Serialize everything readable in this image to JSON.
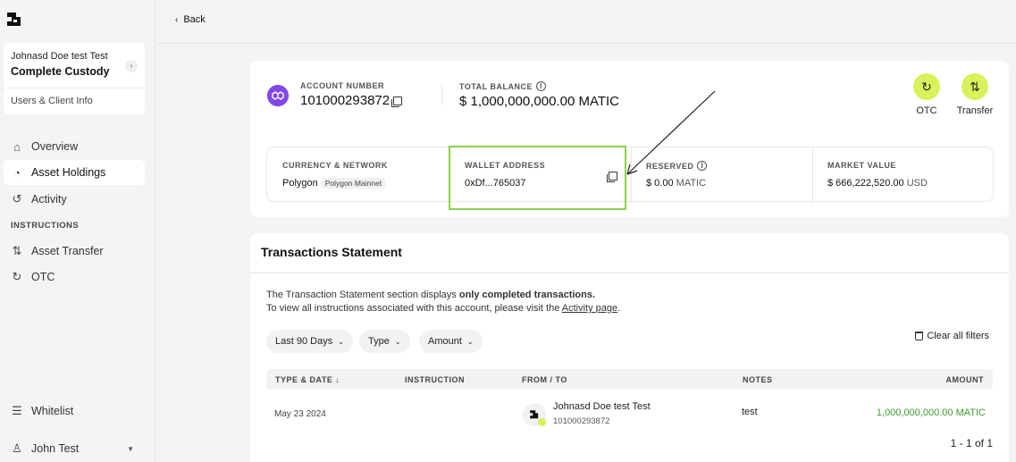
{
  "sidebar": {
    "client": {
      "name": "Johnasd Doe test Test",
      "type": "Complete Custody",
      "users_link": "Users & Client Info"
    },
    "nav": [
      {
        "label": "Overview",
        "icon": "home-icon"
      },
      {
        "label": "Asset Holdings",
        "icon": "pie-chart-icon",
        "active": true
      },
      {
        "label": "Activity",
        "icon": "history-icon"
      }
    ],
    "instructions_heading": "INSTRUCTIONS",
    "instructions": [
      {
        "label": "Asset Transfer",
        "icon": "transfer-arrows-icon"
      },
      {
        "label": "OTC",
        "icon": "refresh-icon"
      }
    ],
    "whitelist": "Whitelist",
    "user": "John Test"
  },
  "header": {
    "back": "Back"
  },
  "account": {
    "number_label": "ACCOUNT NUMBER",
    "number": "101000293872",
    "balance_label": "TOTAL BALANCE",
    "balance": "$ 1,000,000,000.00 MATIC",
    "otc_label": "OTC",
    "transfer_label": "Transfer",
    "currency_label": "CURRENCY & NETWORK",
    "currency": "Polygon",
    "network": "Polygon Mainnet",
    "wallet_label": "WALLET ADDRESS",
    "wallet": "0xDf...765037",
    "reserved_label": "RESERVED",
    "reserved_value": "$ 0.00",
    "reserved_unit": "MATIC",
    "market_label": "MARKET VALUE",
    "market_value": "$ 666,222,520.00",
    "market_unit": "USD",
    "accent_color": "#d7f25b",
    "highlight_color": "#89d34a"
  },
  "transactions": {
    "title": "Transactions Statement",
    "desc_prefix": "The Transaction Statement section displays ",
    "desc_bold": "only completed transactions.",
    "desc2_prefix": "To view all instructions associated with this account, please visit the ",
    "desc2_link": "Activity page",
    "desc2_suffix": ".",
    "filters": [
      "Last 90 Days",
      "Type",
      "Amount"
    ],
    "clear_filters": "Clear all filters",
    "columns": [
      "TYPE & DATE",
      "INSTRUCTION",
      "FROM / TO",
      "NOTES",
      "AMOUNT"
    ],
    "rows": [
      {
        "date": "May 23 2024",
        "instruction": "",
        "from_name": "Johnasd Doe test Test",
        "from_account": "101000293872",
        "notes": "test",
        "amount": "1,000,000,000.00 MATIC"
      }
    ],
    "pagination": "1 - 1 of 1"
  }
}
